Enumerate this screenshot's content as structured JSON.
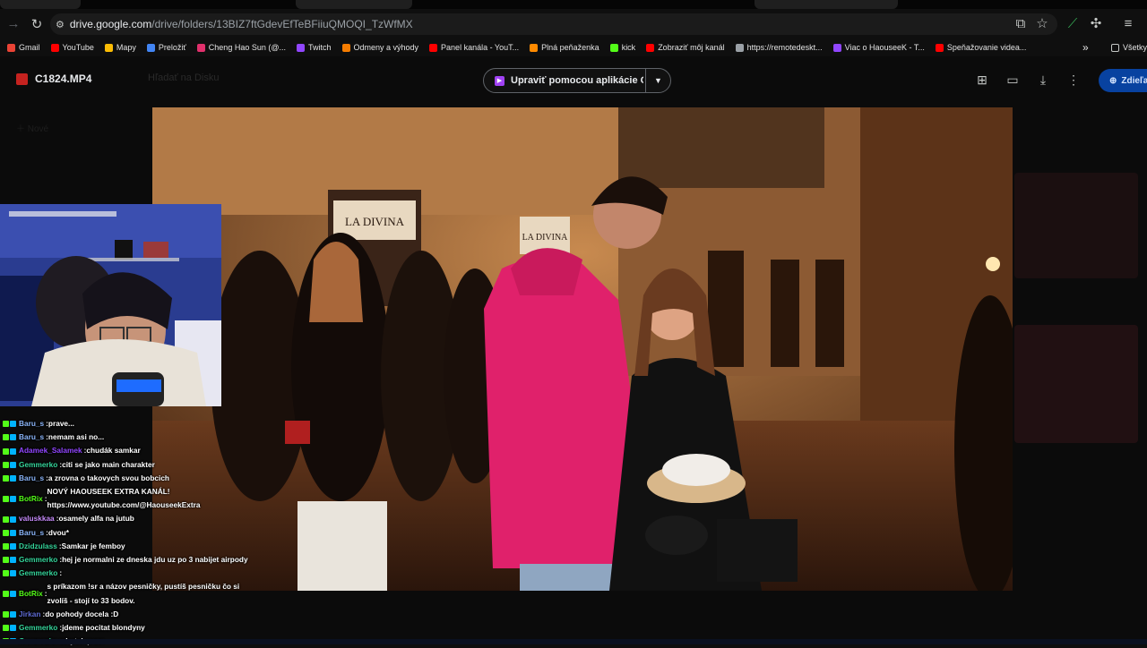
{
  "browser": {
    "url_host": "drive.google.com",
    "url_path": "/drive/folders/13BIZ7ftGdevEfTeBFiiuQMOQI_TzWfMX",
    "bookmarks": [
      {
        "label": "Gmail",
        "color": "#ea4335"
      },
      {
        "label": "YouTube",
        "color": "#ff0000"
      },
      {
        "label": "Mapy",
        "color": "#fbbc04"
      },
      {
        "label": "Preložiť",
        "color": "#4285f4"
      },
      {
        "label": "Cheng Hao Sun (@...",
        "color": "#e1306c"
      },
      {
        "label": "Twitch",
        "color": "#9146ff"
      },
      {
        "label": "Odmeny a výhody",
        "color": "#f57c00"
      },
      {
        "label": "Panel kanála - YouT...",
        "color": "#ff0000"
      },
      {
        "label": "Plná peňaženka",
        "color": "#ff8a00"
      },
      {
        "label": "kick",
        "color": "#53fc18"
      },
      {
        "label": "Zobraziť môj kanál",
        "color": "#ff0000"
      },
      {
        "label": "https://remotedeskt...",
        "color": "#9aa0a6"
      },
      {
        "label": "Viac o HaouseeK - T...",
        "color": "#9146ff"
      },
      {
        "label": "Speňažovanie videa...",
        "color": "#ff0000"
      }
    ],
    "bookmarks_overflow": "»",
    "bookmarks_folder": "Všetky"
  },
  "drive": {
    "file_name": "C1824.MP4",
    "search_placeholder": "Hľadať na Disku",
    "edit_button_label": "Upraviť pomocou aplikácie G...",
    "share_label": "Zdieľať"
  },
  "video_scene": {
    "sign_1": "LA DIVINA",
    "sign_2": "LA DIVINA"
  },
  "chat": [
    {
      "user": "Baru_s",
      "color": "#8ab4f8",
      "text": "prave..."
    },
    {
      "user": "Baru_s",
      "color": "#8ab4f8",
      "text": "nemam asi no..."
    },
    {
      "user": "Adamek_Salamek",
      "color": "#9146ff",
      "text": "chudák samkar"
    },
    {
      "user": "Gemmerko",
      "color": "#34d399",
      "text": "citi se jako main charakter"
    },
    {
      "user": "Baru_s",
      "color": "#8ab4f8",
      "text": "a zrovna o takovych svou bobcich"
    },
    {
      "user": "BotRix",
      "color": "#53fc18",
      "text": "NOVÝ HAOUSEEK EXTRA KANÁL! https://www.youtube.com/@HaouseekExtra",
      "wrap": true
    },
    {
      "user": "valuskkaa",
      "color": "#c58af9",
      "text": "osamely alfa na jutub"
    },
    {
      "user": "Baru_s",
      "color": "#8ab4f8",
      "text": "dvou*"
    },
    {
      "user": "Dzidzulass",
      "color": "#34d399",
      "text": "Samkar je femboy"
    },
    {
      "user": "Gemmerko",
      "color": "#34d399",
      "text": "hej je normalni ze dneska jdu uz po 3 nabijet airpody"
    },
    {
      "user": "Gemmerko",
      "color": "#34d399",
      "text": ""
    },
    {
      "user": "BotRix",
      "color": "#53fc18",
      "text": "s príkazom !sr a názov pesničky, pustíš pesničku čo si zvolíš - stojí to 33 bodov.",
      "wrap": true
    },
    {
      "user": "Jirkan",
      "color": "#5e6ad2",
      "text": "do pohody docela :D"
    },
    {
      "user": "Gemmerko",
      "color": "#34d399",
      "text": "jdeme pocitat blondyny"
    },
    {
      "user": "Gemmerko",
      "color": "#34d399",
      "text": "zbytek pass"
    }
  ]
}
